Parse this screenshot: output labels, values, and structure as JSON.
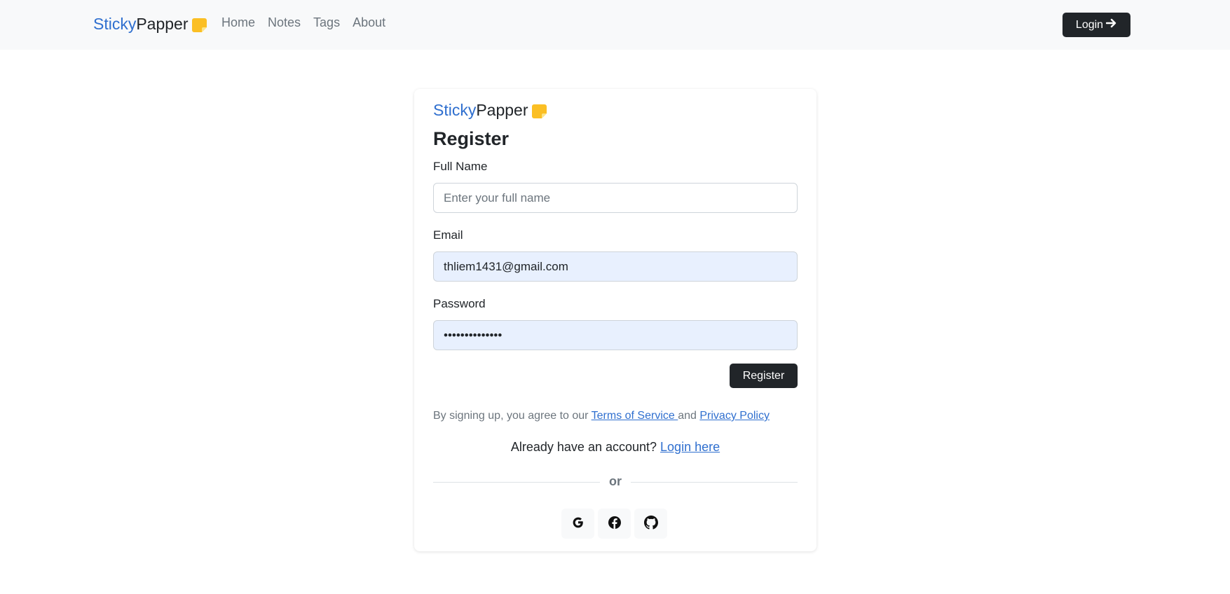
{
  "brand": {
    "part1": "Sticky",
    "part2": "Papper",
    "icon": "sticky-note-icon"
  },
  "nav": {
    "items": [
      {
        "label": "Home"
      },
      {
        "label": "Notes"
      },
      {
        "label": "Tags"
      },
      {
        "label": "About"
      }
    ]
  },
  "header": {
    "login_label": "Login",
    "login_icon": "arrow-right-icon"
  },
  "form": {
    "title": "Register",
    "full_name": {
      "label": "Full Name",
      "placeholder": "Enter your full name",
      "value": ""
    },
    "email": {
      "label": "Email",
      "value": "thliem1431@gmail.com"
    },
    "password": {
      "label": "Password",
      "value": "••••••••••••••"
    },
    "submit_label": "Register"
  },
  "terms": {
    "prefix": "By signing up, you agree to our ",
    "tos": "Terms of Service ",
    "middle": "and ",
    "privacy": "Privacy Policy"
  },
  "already": {
    "text": "Already have an account? ",
    "link": "Login here"
  },
  "divider": {
    "text": "or"
  },
  "socials": [
    {
      "icon": "google-icon"
    },
    {
      "icon": "facebook-icon"
    },
    {
      "icon": "github-icon"
    }
  ],
  "colors": {
    "accent": "#2f6fcf",
    "dark": "#212529",
    "note": "#fbbf24",
    "autofill": "#e8f0fe"
  }
}
